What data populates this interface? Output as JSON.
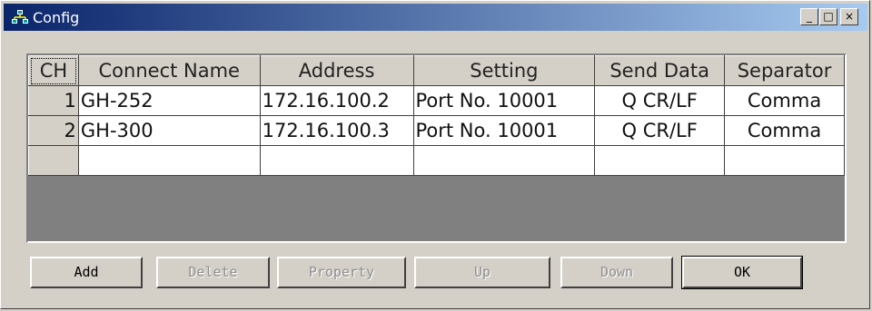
{
  "window": {
    "title": "Config",
    "min_label": "_",
    "max_label": "□",
    "close_label": "×"
  },
  "table": {
    "headers": [
      "CH",
      "Connect Name",
      "Address",
      "Setting",
      "Send Data",
      "Separator"
    ],
    "rows": [
      [
        "1",
        "GH-252",
        "172.16.100.2",
        "Port No. 10001",
        "Q  CR/LF",
        "Comma"
      ],
      [
        "2",
        "GH-300",
        "172.16.100.3",
        "Port No. 10001",
        "Q  CR/LF",
        "Comma"
      ],
      [
        "",
        "",
        "",
        "",
        "",
        ""
      ]
    ]
  },
  "buttons": {
    "add": "Add",
    "delete": "Delete",
    "property": "Property",
    "up": "Up",
    "down": "Down",
    "ok": "OK"
  },
  "colors": {
    "titlebar_start": "#0a246a",
    "titlebar_end": "#a6caf0",
    "face": "#d4d0c8"
  }
}
